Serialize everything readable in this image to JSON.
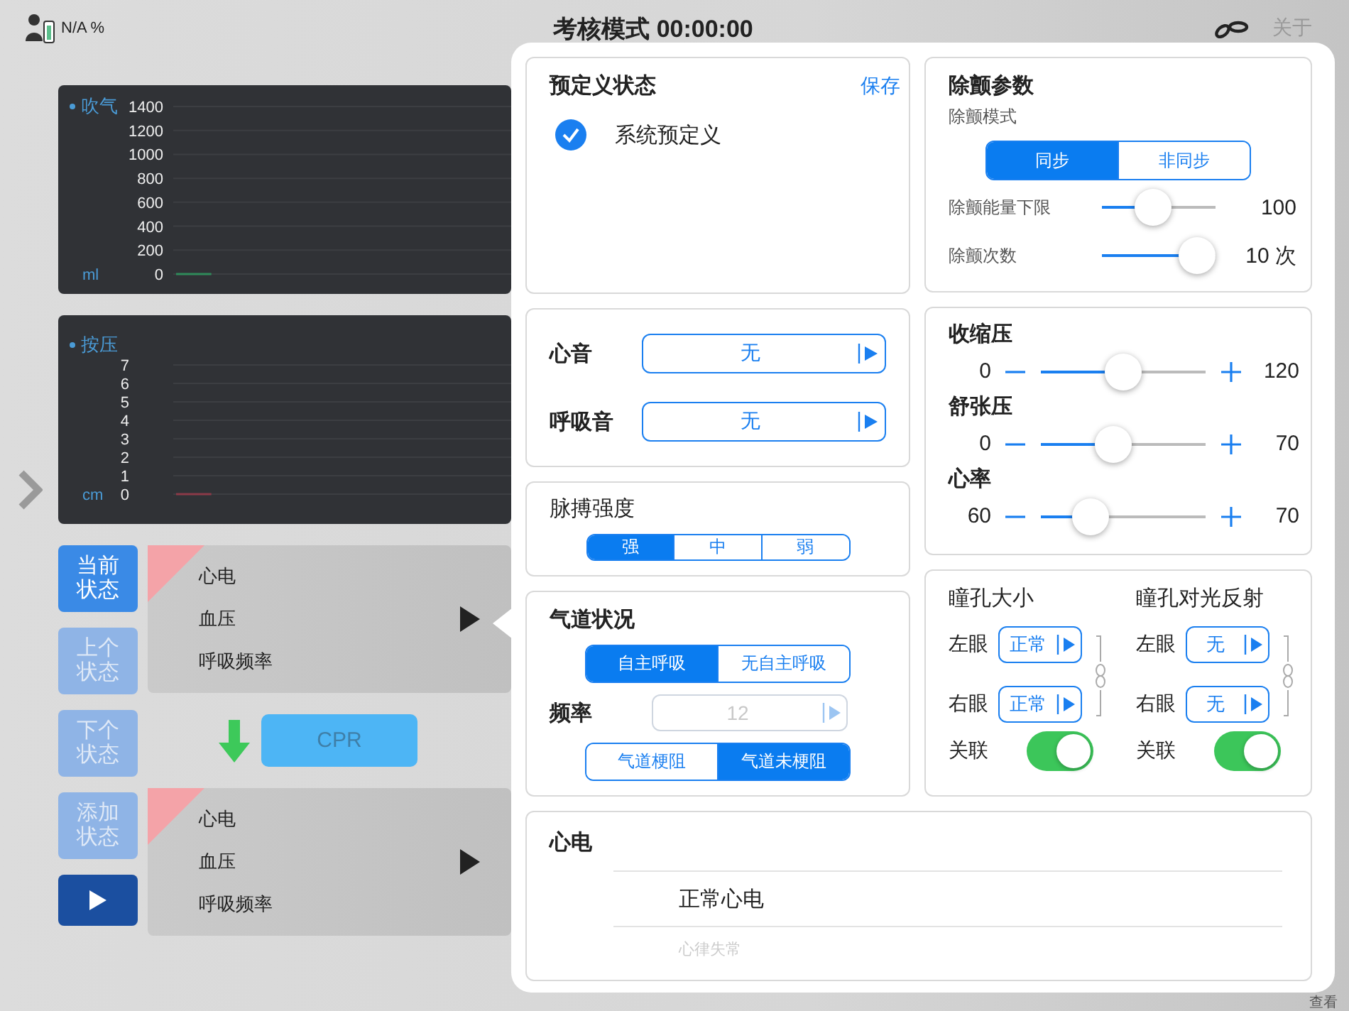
{
  "top_bar": {
    "battery": "N/A %",
    "title": "考核模式 00:00:00",
    "about": "关于"
  },
  "charts": [
    {
      "chart_data": {
        "type": "line",
        "ylabel": "ml",
        "yticks": [
          0,
          200,
          400,
          600,
          800,
          1000,
          1200,
          1400
        ],
        "ylim": [
          0,
          1400
        ],
        "grid": true,
        "series": [
          {
            "name": "吹气",
            "color": "#2f8a5a",
            "values": [
              0,
              0,
              0,
              null,
              null,
              null,
              null,
              null,
              null,
              null,
              null,
              null,
              null,
              null,
              null,
              null,
              null,
              null,
              null,
              null
            ]
          }
        ]
      }
    },
    {
      "chart_data": {
        "type": "line",
        "ylabel": "cm",
        "yticks": [
          0,
          1,
          2,
          3,
          4,
          5,
          6,
          7
        ],
        "ylim": [
          0,
          7
        ],
        "grid": true,
        "series": [
          {
            "name": "按压",
            "color": "#8a3a48",
            "values": [
              0,
              0,
              0,
              null,
              null,
              null,
              null,
              null,
              null,
              null,
              null,
              null,
              null,
              null,
              null,
              null,
              null,
              null,
              null,
              null
            ]
          }
        ]
      }
    }
  ],
  "state_buttons": [
    {
      "label": "当前状态",
      "selected": true
    },
    {
      "label": "上个状态",
      "selected": false
    },
    {
      "label": "下个状态",
      "selected": false
    },
    {
      "label": "添加状态",
      "selected": false
    }
  ],
  "state_cards": [
    {
      "items": [
        "心电",
        "血压",
        "呼吸频率"
      ]
    },
    {
      "items": [
        "心电",
        "血压",
        "呼吸频率"
      ]
    }
  ],
  "transition": "CPR",
  "predefined": {
    "title": "预定义状态",
    "save": "保存",
    "options": [
      {
        "label": "系统预定义",
        "checked": true
      }
    ]
  },
  "sounds": [
    {
      "label": "心音",
      "value": "无"
    },
    {
      "label": "呼吸音",
      "value": "无"
    }
  ],
  "pulse": {
    "title": "脉搏强度",
    "options": [
      {
        "label": "强",
        "selected": true
      },
      {
        "label": "中",
        "selected": false
      },
      {
        "label": "弱",
        "selected": false
      }
    ]
  },
  "airway": {
    "title": "气道状况",
    "modes": [
      {
        "label": "自主呼吸",
        "selected": true
      },
      {
        "label": "无自主呼吸",
        "selected": false
      }
    ],
    "rate_label": "频率",
    "rate": "12",
    "rate_disabled": true,
    "obstruction": [
      {
        "label": "气道梗阻",
        "selected": false
      },
      {
        "label": "气道未梗阻",
        "selected": true
      }
    ]
  },
  "defib": {
    "title": "除颤参数",
    "mode_label": "除颤模式",
    "modes": [
      {
        "label": "同步",
        "selected": true
      },
      {
        "label": "非同步",
        "selected": false
      }
    ],
    "sliders": [
      {
        "label": "除颤能量下限",
        "level": 0.43,
        "reading": "100"
      },
      {
        "label": "除颤次数",
        "level": 1.0,
        "reading": "10 次"
      }
    ]
  },
  "vitals": [
    {
      "label": "收缩压",
      "min": "0",
      "level": 0.5,
      "reading": "120"
    },
    {
      "label": "舒张压",
      "min": "0",
      "level": 0.42,
      "reading": "70"
    },
    {
      "label": "心率",
      "min": "60",
      "level": 0.24,
      "reading": "70"
    }
  ],
  "pupils": [
    {
      "title": "瞳孔大小",
      "rows": [
        {
          "label": "左眼",
          "value": "正常"
        },
        {
          "label": "右眼",
          "value": "正常"
        }
      ],
      "link_label": "关联",
      "on": true
    },
    {
      "title": "瞳孔对光反射",
      "rows": [
        {
          "label": "左眼",
          "value": "无"
        },
        {
          "label": "右眼",
          "value": "无"
        }
      ],
      "link_label": "关联",
      "on": true
    }
  ],
  "ecg": {
    "title": "心电",
    "options": [
      {
        "label": "正常心电",
        "selected": true
      },
      {
        "label": "心律失常",
        "selected": false
      }
    ]
  },
  "view_label": "查看"
}
